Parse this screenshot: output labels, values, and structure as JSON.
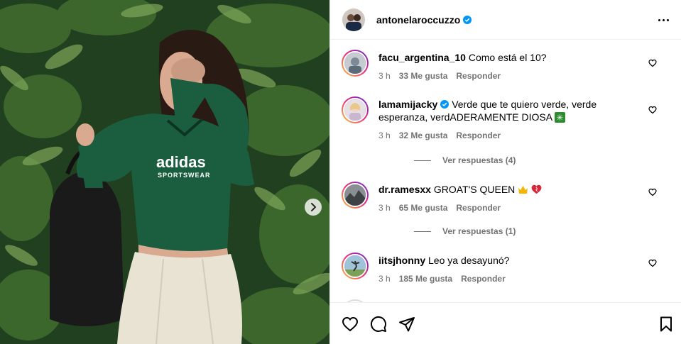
{
  "post": {
    "author": "antonelaroccuzzo",
    "brand_text_1": "adidas",
    "brand_text_2": "SPORTSWEAR"
  },
  "comments": [
    {
      "user": "facu_argentina_10",
      "text": "Como está el 10?",
      "time": "3 h",
      "likes": "33 Me gusta",
      "reply": "Responder"
    },
    {
      "user": "lamamijacky",
      "verified": true,
      "text": "Verde que te quiero verde, verde esperanza, verdADERAMENTE DIOSA",
      "time": "3 h",
      "likes": "32 Me gusta",
      "reply": "Responder",
      "replies": "Ver respuestas (4)"
    },
    {
      "user": "dr.ramesxx",
      "text": "GROAT'S QUEEN",
      "time": "3 h",
      "likes": "65 Me gusta",
      "reply": "Responder",
      "replies": "Ver respuestas (1)"
    },
    {
      "user": "iitsjhonny",
      "text": "Leo ya desayunó?",
      "time": "3 h",
      "likes": "185 Me gusta",
      "reply": "Responder"
    }
  ],
  "colors": {
    "verified": "#0095f6",
    "meta_text": "#737373",
    "jersey": "#1b5e3f"
  },
  "icons": [
    "chevron-right-icon",
    "more-icon",
    "heart-icon",
    "comment-icon",
    "share-icon",
    "bookmark-icon",
    "verified-icon"
  ]
}
